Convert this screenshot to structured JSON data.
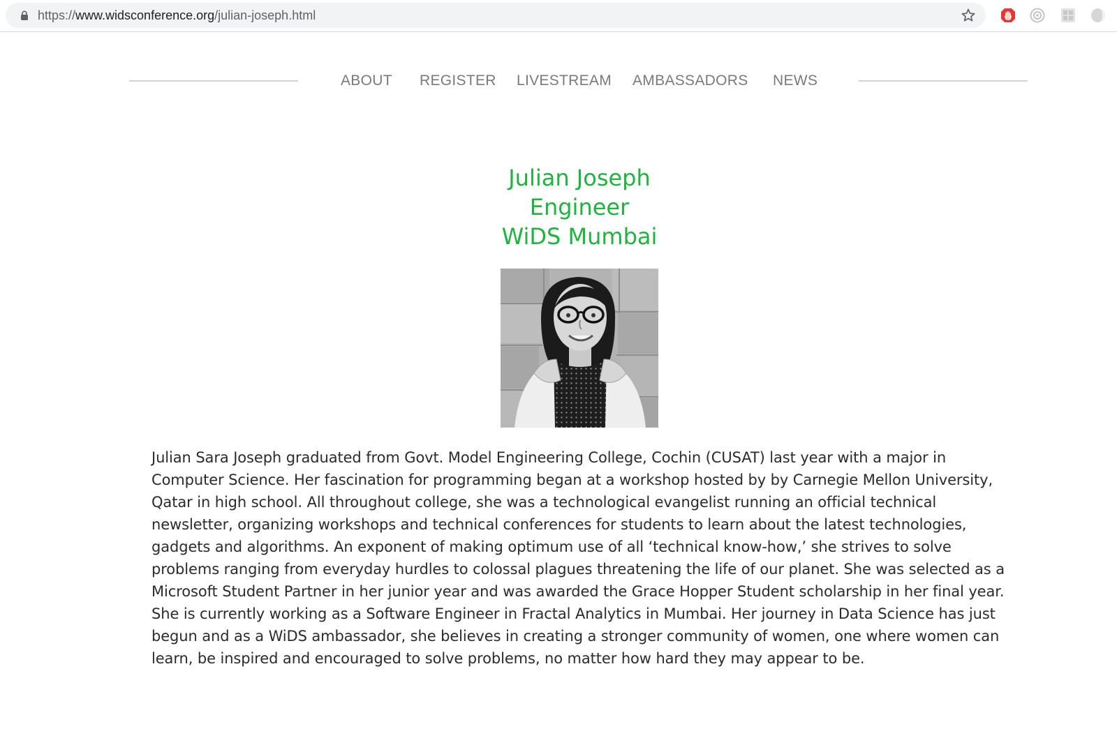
{
  "browser": {
    "url_scheme": "https://",
    "url_host": "www.widsconference.org",
    "url_path": "/julian-joseph.html",
    "icons": [
      "lock-icon",
      "star-icon",
      "adblock-extension-icon",
      "camera-extension-icon",
      "grid-extension-icon",
      "profile-extension-icon"
    ]
  },
  "nav": {
    "items": [
      "ABOUT",
      "REGISTER",
      "LIVESTREAM",
      "AMBASSADORS",
      "NEWS"
    ]
  },
  "profile": {
    "name": "Julian Joseph",
    "role": "Engineer",
    "location": "WiDS Mumbai",
    "bio": "Julian Sara Joseph graduated from Govt. Model Engineering College, Cochin (CUSAT) last year with a major in Computer Science. Her fascination for programming began at a workshop hosted by by Carnegie Mellon University, Qatar in high school. All throughout college, she was a technological evangelist running an official technical newsletter, organizing workshops and technical conferences for students to learn about the latest technologies, gadgets and algorithms. An exponent of making optimum use of all ‘technical know-how,’ she strives to solve problems ranging from everyday hurdles to colossal plagues threatening the life of our planet. She was selected as a Microsoft Student Partner in her junior year and was awarded the Grace Hopper Student scholarship in her final year. She is currently working as a Software Engineer in Fractal Analytics in Mumbai. Her journey in Data Science has just begun and as a WiDS ambassador, she believes in creating a stronger community of women, one where women can learn, be inspired and encouraged to solve problems, no matter how hard they may appear to be."
  },
  "colors": {
    "accent_green": "#1fb33f",
    "nav_text": "#7a7a7a",
    "body_text": "#2b2b2b",
    "omnibox_bg": "#f1f3f4"
  }
}
